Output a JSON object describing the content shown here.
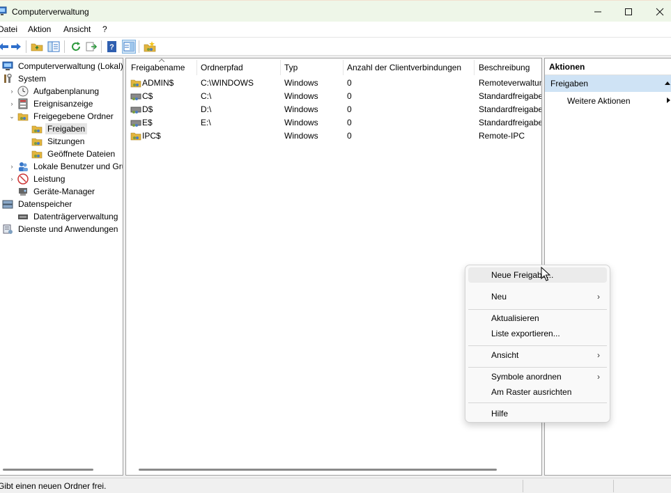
{
  "window": {
    "title": "Computerverwaltung"
  },
  "menu": [
    "Datei",
    "Aktion",
    "Ansicht",
    "?"
  ],
  "tree": [
    {
      "label": "Computerverwaltung (Lokal)",
      "icon": "computer-management-icon"
    },
    {
      "label": "System",
      "icon": "tools-icon"
    },
    {
      "label": "Aufgabenplanung",
      "icon": "clock-icon"
    },
    {
      "label": "Ereignisanzeige",
      "icon": "event-viewer-icon"
    },
    {
      "label": "Freigegebene Ordner",
      "icon": "shared-folder-icon"
    },
    {
      "label": "Freigaben",
      "icon": "shared-folder-icon"
    },
    {
      "label": "Sitzungen",
      "icon": "shared-folder-icon"
    },
    {
      "label": "Geöffnete Dateien",
      "icon": "shared-folder-icon"
    },
    {
      "label": "Lokale Benutzer und Gruppen",
      "icon": "users-icon"
    },
    {
      "label": "Leistung",
      "icon": "performance-icon"
    },
    {
      "label": "Geräte-Manager",
      "icon": "device-manager-icon"
    },
    {
      "label": "Datenspeicher",
      "icon": "storage-icon"
    },
    {
      "label": "Datenträgerverwaltung",
      "icon": "disk-icon"
    },
    {
      "label": "Dienste und Anwendungen",
      "icon": "services-icon"
    }
  ],
  "list": {
    "columns": [
      "Freigabename",
      "Ordnerpfad",
      "Typ",
      "Anzahl der Clientverbindungen",
      "Beschreibung"
    ],
    "rows": [
      {
        "name": "ADMIN$",
        "path": "C:\\WINDOWS",
        "type": "Windows",
        "clients": "0",
        "desc": "Remoteverwaltung"
      },
      {
        "name": "C$",
        "path": "C:\\",
        "type": "Windows",
        "clients": "0",
        "desc": "Standardfreigabe"
      },
      {
        "name": "D$",
        "path": "D:\\",
        "type": "Windows",
        "clients": "0",
        "desc": "Standardfreigabe"
      },
      {
        "name": "E$",
        "path": "E:\\",
        "type": "Windows",
        "clients": "0",
        "desc": "Standardfreigabe"
      },
      {
        "name": "IPC$",
        "path": "",
        "type": "Windows",
        "clients": "0",
        "desc": "Remote-IPC"
      }
    ]
  },
  "actions": {
    "title": "Aktionen",
    "section": "Freigaben",
    "more": "Weitere Aktionen"
  },
  "context_menu": {
    "items": [
      "Neue Freigabe...",
      "Neu",
      "Aktualisieren",
      "Liste exportieren...",
      "Ansicht",
      "Symbole anordnen",
      "Am Raster ausrichten",
      "Hilfe"
    ],
    "submenu_arrow": "›"
  },
  "status": {
    "text": "Gibt einen neuen Ordner frei."
  },
  "colors": {
    "title_bg": "#eef6e8",
    "selection": "#cfe3f5",
    "folder": "#e2b53e"
  }
}
